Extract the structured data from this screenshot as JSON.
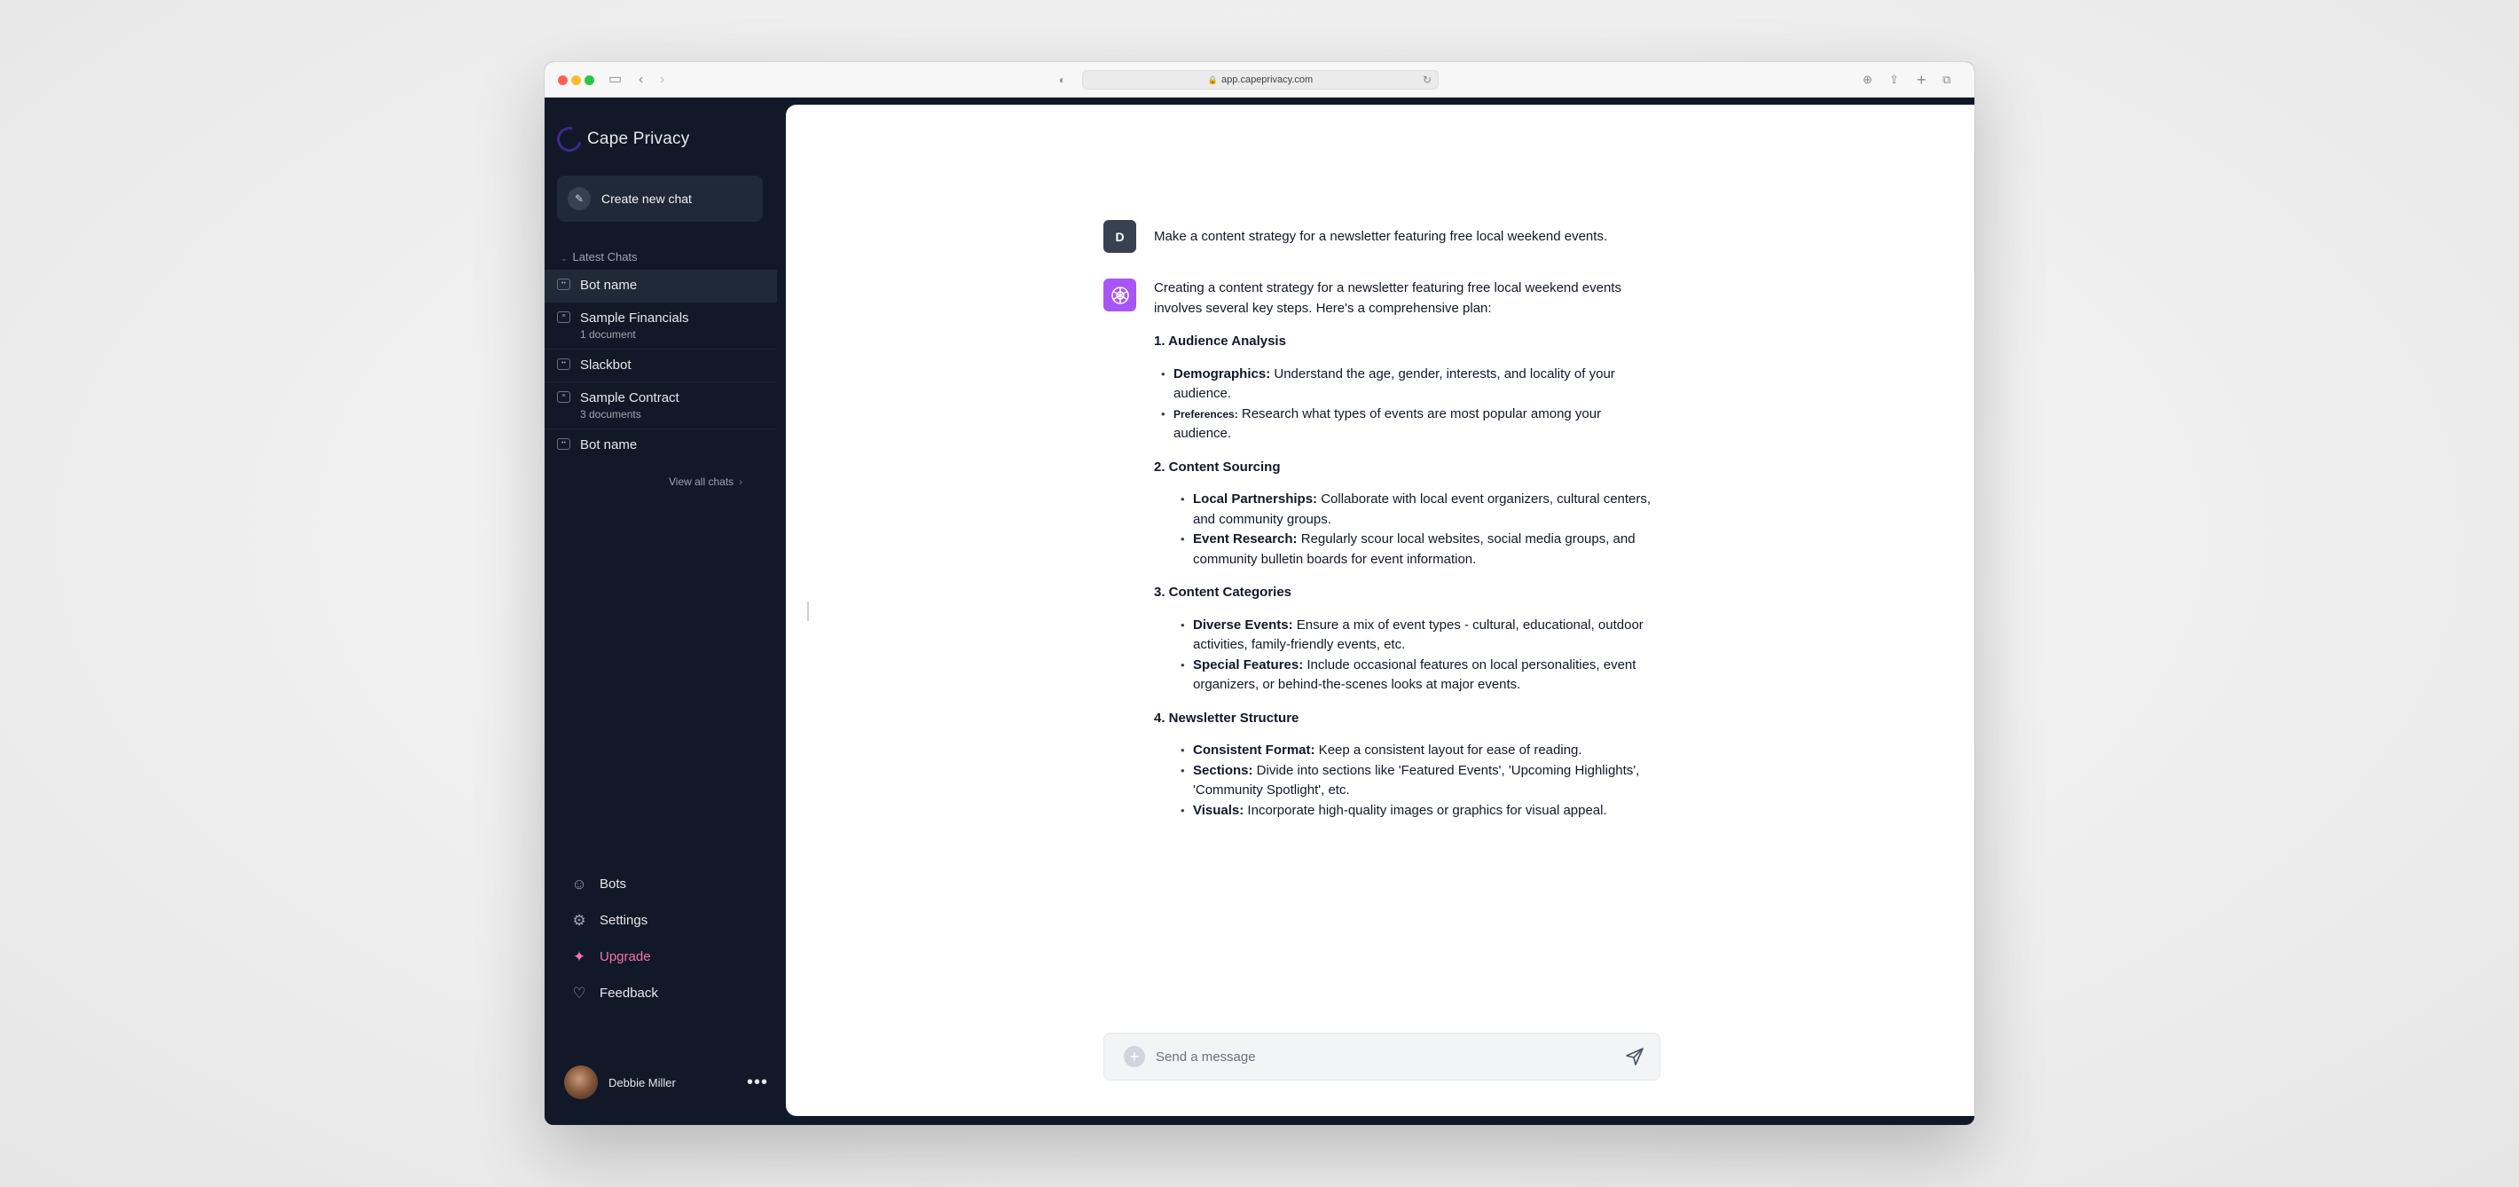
{
  "browser": {
    "url": "app.capeprivacy.com"
  },
  "sidebar": {
    "brand": "Cape Privacy",
    "new_chat_label": "Create new chat",
    "section_label": "Latest Chats",
    "chats": [
      {
        "name": "Bot name",
        "sub": "",
        "type": "bot"
      },
      {
        "name": "Sample Financials",
        "sub": "1 document",
        "type": "doc"
      },
      {
        "name": "Slackbot",
        "sub": "",
        "type": "bot"
      },
      {
        "name": "Sample Contract",
        "sub": "3 documents",
        "type": "doc"
      },
      {
        "name": "Bot name",
        "sub": "",
        "type": "bot"
      }
    ],
    "view_all_label": "View all chats",
    "nav": {
      "bots": "Bots",
      "settings": "Settings",
      "upgrade": "Upgrade",
      "feedback": "Feedback"
    },
    "user_name": "Debbie Miller",
    "accent_color": "#f472b6"
  },
  "conversation": {
    "user_initial": "D",
    "user_message": "Make a content strategy for a newsletter featuring free local weekend events.",
    "bot": {
      "intro": "Creating a content strategy for a newsletter featuring free local weekend events involves several key steps. Here's a comprehensive plan:",
      "sections": [
        {
          "heading": "1. Audience Analysis",
          "items": [
            {
              "label": "Demographics:",
              "text": " Understand the age, gender, interests, and locality of your audience."
            },
            {
              "label": "Preferences:",
              "text": " Research what types of events are most popular among your audience."
            }
          ]
        },
        {
          "heading": "2. Content Sourcing",
          "items": [
            {
              "label": "Local Partnerships:",
              "text": " Collaborate with local event organizers, cultural centers, and community groups."
            },
            {
              "label": "Event Research:",
              "text": " Regularly scour local websites, social media groups, and community bulletin boards for event information."
            }
          ]
        },
        {
          "heading": "3. Content Categories",
          "items": [
            {
              "label": "Diverse Events:",
              "text": " Ensure a mix of event types - cultural, educational, outdoor activities, family-friendly events, etc."
            },
            {
              "label": "Special Features:",
              "text": " Include occasional features on local personalities, event organizers, or behind-the-scenes looks at major events."
            }
          ]
        },
        {
          "heading": "4. Newsletter Structure",
          "items": [
            {
              "label": "Consistent Format:",
              "text": " Keep a consistent layout for ease of reading."
            },
            {
              "label": "Sections:",
              "text": " Divide into sections like 'Featured Events', 'Upcoming Highlights', 'Community Spotlight', etc."
            },
            {
              "label": "Visuals:",
              "text": " Incorporate high-quality images or graphics for visual appeal."
            }
          ]
        }
      ]
    }
  },
  "composer": {
    "placeholder": "Send a message",
    "value": ""
  }
}
